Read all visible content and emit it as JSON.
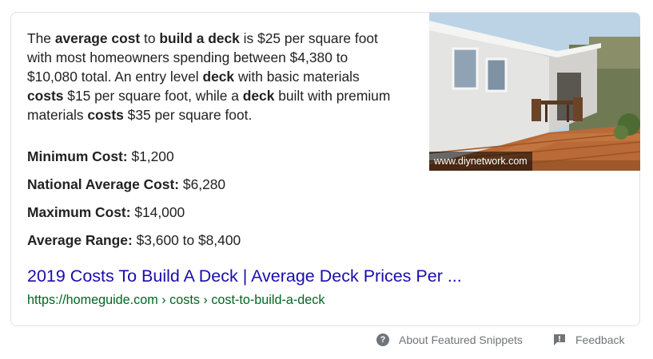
{
  "snippet": {
    "description": [
      {
        "text": "The ",
        "bold": false
      },
      {
        "text": "average cost",
        "bold": true
      },
      {
        "text": " to ",
        "bold": false
      },
      {
        "text": "build a deck",
        "bold": true
      },
      {
        "text": " is $25 per square foot with most homeowners spending between $4,380 to $10,080 total. An entry level ",
        "bold": false
      },
      {
        "text": "deck",
        "bold": true
      },
      {
        "text": " with basic materials ",
        "bold": false
      },
      {
        "text": "costs",
        "bold": true
      },
      {
        "text": " $15 per square foot, while a ",
        "bold": false
      },
      {
        "text": "deck",
        "bold": true
      },
      {
        "text": " built with premium materials ",
        "bold": false
      },
      {
        "text": "costs",
        "bold": true
      },
      {
        "text": " $35 per square foot.",
        "bold": false
      }
    ],
    "stats": [
      {
        "label": "Minimum Cost:",
        "value": "$1,200"
      },
      {
        "label": "National Average Cost:",
        "value": "$6,280"
      },
      {
        "label": "Maximum Cost:",
        "value": "$14,000"
      },
      {
        "label": "Average Range:",
        "value": "$3,600 to $8,400"
      }
    ],
    "image_caption": "www.diynetwork.com",
    "result_title": "2019 Costs To Build A Deck | Average Deck Prices Per ...",
    "result_url": "https://homeguide.com › costs › cost-to-build-a-deck"
  },
  "footer": {
    "about_label": "About Featured Snippets",
    "feedback_label": "Feedback",
    "about_icon": "help-circle-icon",
    "feedback_icon": "feedback-flag-icon"
  },
  "colors": {
    "link": "#1a0dab",
    "url": "#006621",
    "text": "#222222",
    "muted": "#70757a"
  }
}
